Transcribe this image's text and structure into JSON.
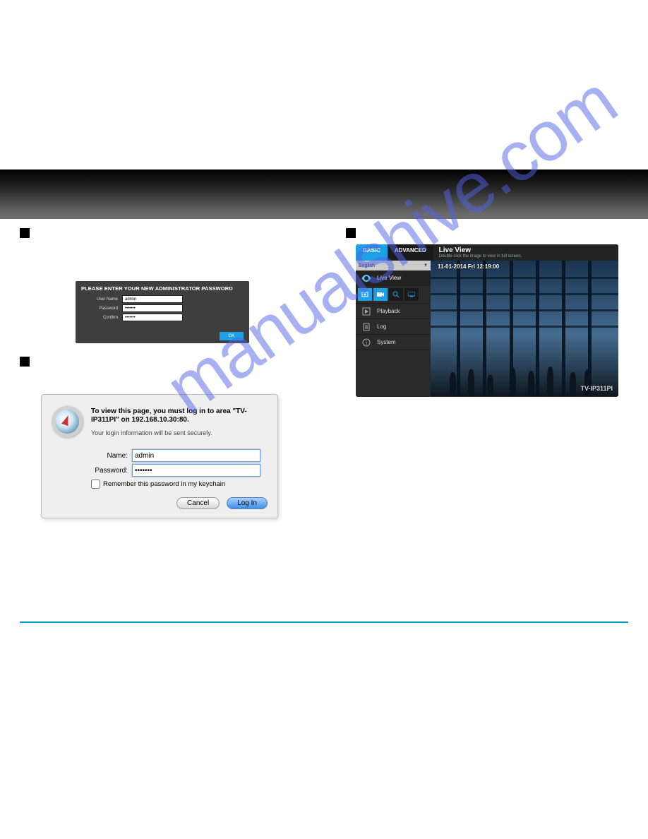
{
  "admin_panel": {
    "title": "PLEASE ENTER YOUR NEW ADMINISTRATOR PASSWORD",
    "username_label": "User Name",
    "username_value": "admin",
    "password_label": "Password",
    "password_value": "•••••••",
    "confirm_label": "Confirm",
    "confirm_value": "•••••••",
    "ok_label": "OK"
  },
  "mac_dialog": {
    "message_bold": "To view this page, you must log in to area \"TV-IP311PI\" on 192.168.10.30:80.",
    "message_sub": "Your login information will be sent securely.",
    "name_label": "Name:",
    "name_value": "admin",
    "password_label": "Password:",
    "password_value": "•••••••",
    "remember_label": "Remember this password in my keychain",
    "cancel_label": "Cancel",
    "login_label": "Log In"
  },
  "cam_ui": {
    "tab_basic": "BASIC",
    "tab_advanced": "ADVANCED",
    "header_title": "Live View",
    "header_sub": "Double click the image to view in full screen.",
    "language_selected": "English",
    "menu_live_view": "Live View",
    "menu_playback": "Playback",
    "menu_log": "Log",
    "menu_system": "System",
    "overlay_timestamp": "11-01-2014   Fri 12:19:00",
    "model_watermark": "TV-IP311PI"
  },
  "page_watermark": "manualshive.com"
}
